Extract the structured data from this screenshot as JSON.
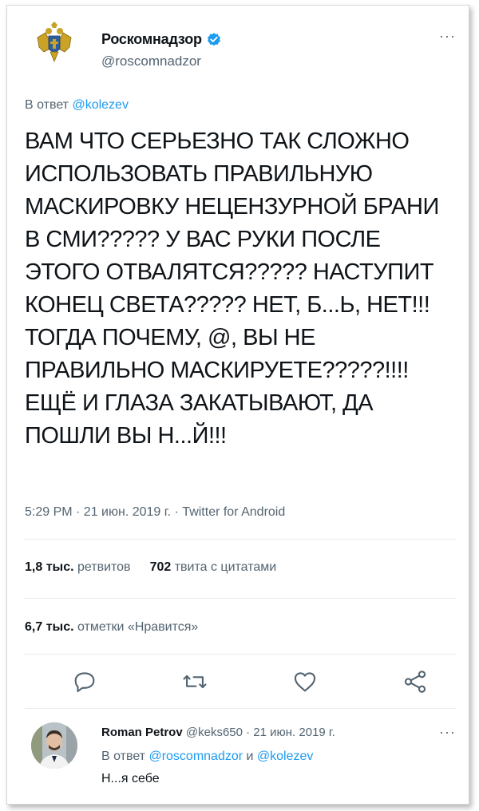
{
  "tweet": {
    "display_name": "Роскомнадзор",
    "handle": "@roscomnadzor",
    "more": "···",
    "reply_prefix": "В ответ ",
    "reply_mention": "@kolezev",
    "text": "ВАМ ЧТО СЕРЬЕЗНО ТАК СЛОЖНО ИСПОЛЬЗОВАТЬ ПРАВИЛЬНУЮ МАСКИРОВКУ НЕЦЕНЗУРНОЙ БРАНИ В СМИ????? У ВАС РУКИ ПОСЛЕ ЭТОГО ОТВАЛЯТСЯ????? НАСТУПИТ КОНЕЦ СВЕТА????? НЕТ, Б...Ь, НЕТ!!! ТОГДА ПОЧЕМУ, @, ВЫ НЕ ПРАВИЛЬНО МАСКИРУЕТЕ?????!!!! ЕЩЁ И ГЛАЗА ЗАКАТЫВАЮТ, ДА ПОШЛИ ВЫ Н...Й!!!",
    "meta": "5:29 PM · 21 июн. 2019 г. · Twitter for Android",
    "retweets_count": "1,8 тыс.",
    "retweets_label": " ретвитов",
    "quotes_count": "702",
    "quotes_label": " твита с цитатами",
    "likes_count": "6,7 тыс.",
    "likes_label": " отметки «Нравится»"
  },
  "reply": {
    "name": "Roman Petrov",
    "handle_date": " @keks650 · 21 июн. 2019 г.",
    "more": "···",
    "reply_prefix": "В ответ ",
    "mention1": "@roscomnadzor",
    "conj": " и ",
    "mention2": "@kolezev",
    "text": "Н...я себе"
  },
  "icons": {
    "reply": "reply-icon",
    "retweet": "retweet-icon",
    "like": "like-icon",
    "share": "share-icon",
    "verified": "verified-badge-icon"
  },
  "colors": {
    "accent": "#1d9bf0",
    "secondary_text": "#536471",
    "primary_text": "#0f1419"
  }
}
